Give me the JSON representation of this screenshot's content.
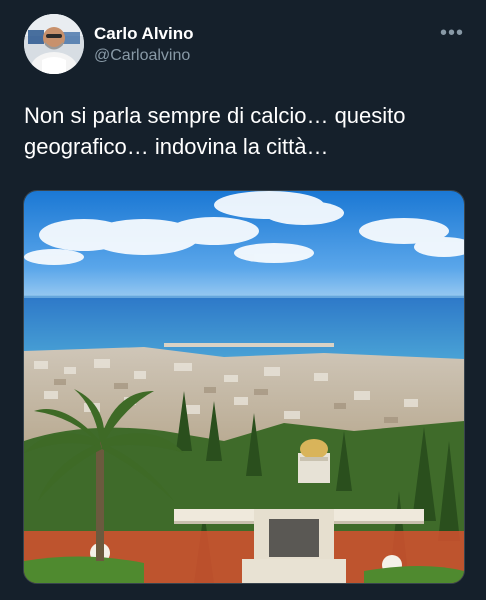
{
  "author": {
    "name": "Carlo Alvino",
    "handle": "@Carloalvino"
  },
  "tweet": {
    "text": "Non si parla sempre di calcio… quesito\ngeografico… indovina la città…"
  },
  "menu": {
    "icon": "more-horizontal-icon",
    "glyph": "•••"
  },
  "media": {
    "subject": "photo-coastal-city-terraced-gardens"
  },
  "colors": {
    "background": "#15202b",
    "text": "#ffffff",
    "secondary": "#8899a6"
  }
}
